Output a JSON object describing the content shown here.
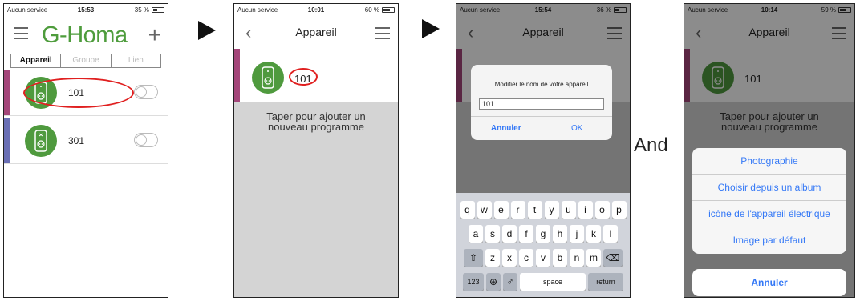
{
  "phone1": {
    "status": {
      "carrier": "Aucun service",
      "time": "15:53",
      "battery": "35 %"
    },
    "brand": "G-Homa",
    "tabs": [
      "Appareil",
      "Groupe",
      "Lien"
    ],
    "devices": [
      {
        "name": "101",
        "stripe": "#a4467a"
      },
      {
        "name": "301",
        "stripe": "#6a6fb5"
      }
    ]
  },
  "phone2": {
    "status": {
      "carrier": "Aucun service",
      "time": "10:01",
      "battery": "60 %"
    },
    "title": "Appareil",
    "device_name": "101",
    "add_program_line1": "Taper pour ajouter un",
    "add_program_line2": "nouveau programme"
  },
  "phone3": {
    "status": {
      "carrier": "Aucun service",
      "time": "15:54",
      "battery": "36 %"
    },
    "title": "Appareil",
    "dialog_message": "Modifier le nom de votre appareil",
    "dialog_value": "101",
    "cancel_label": "Annuler",
    "ok_label": "OK",
    "keyboard": {
      "row1": [
        "q",
        "w",
        "e",
        "r",
        "t",
        "y",
        "u",
        "i",
        "o",
        "p"
      ],
      "row2": [
        "a",
        "s",
        "d",
        "f",
        "g",
        "h",
        "j",
        "k",
        "l"
      ],
      "row3": [
        "z",
        "x",
        "c",
        "v",
        "b",
        "n",
        "m"
      ],
      "numbers_key": "123",
      "space_key": "space",
      "return_key": "return"
    }
  },
  "separator": {
    "and_label": "And"
  },
  "phone4": {
    "status": {
      "carrier": "Aucun service",
      "time": "10:14",
      "battery": "59 %"
    },
    "title": "Appareil",
    "device_name": "101",
    "add_program_line1": "Taper pour ajouter un",
    "add_program_line2": "nouveau programme",
    "sheet_options": [
      "Photographie",
      "Choisir depuis un album",
      "icône de l'appareil électrique",
      "Image par défaut"
    ],
    "cancel_label": "Annuler"
  },
  "colors": {
    "brand_green": "#4e9c3c",
    "ios_blue": "#3478f6",
    "highlight_red": "#e02020"
  }
}
